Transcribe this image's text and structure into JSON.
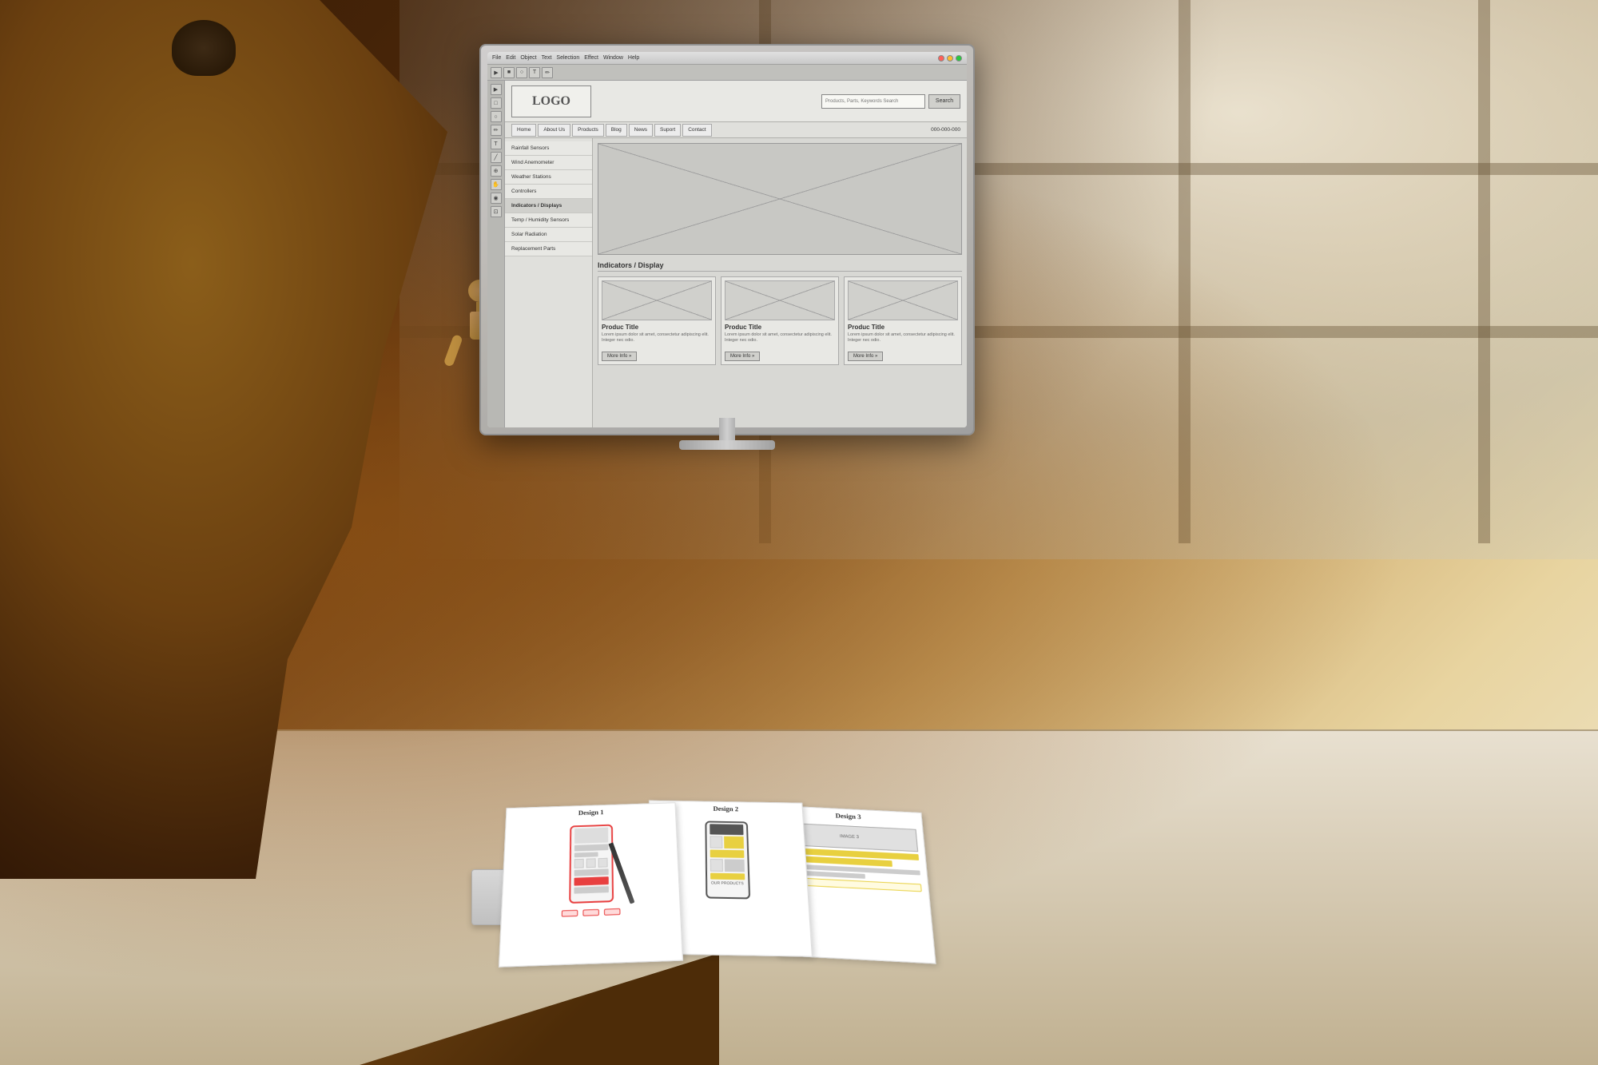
{
  "scene": {
    "title": "UI/UX Designer Working on Wireframe"
  },
  "app": {
    "title_bar": {
      "menus": [
        "File",
        "Edit",
        "Object",
        "Text",
        "Selection",
        "Effect",
        "Window",
        "Help"
      ],
      "window_controls": [
        "close",
        "minimize",
        "maximize"
      ]
    }
  },
  "wireframe": {
    "logo": "LOGO",
    "search_placeholder": "Products, Parts, Keywords Search",
    "search_button": "Search",
    "nav_items": [
      "Home",
      "About Us",
      "Products",
      "Blog",
      "News",
      "Suport",
      "Contact"
    ],
    "phone": "000-000-000",
    "menu_items": [
      "Rainfall Sensors",
      "Wind Anemometer",
      "Weather Stations",
      "Controllers",
      "Indicators / Displays",
      "Temp / Humidity Sensors",
      "Solar Radiation",
      "Replacement Parts"
    ],
    "category_title": "Indicators / Display",
    "products": [
      {
        "title": "Produc Title",
        "description": "Lorem ipsum dolor sit amet, consectetur adipiscing elit. Integer nec odio.",
        "more_info": "More Info »"
      },
      {
        "title": "Produc Title",
        "description": "Lorem ipsum dolor sit amet, consectetur adipiscing elit. Integer nec odio.",
        "more_info": "More Info »"
      },
      {
        "title": "Produc Title",
        "description": "Lorem ipsum dolor sit amet, consectetur adipiscing elit. Integer nec odio.",
        "more_info": "More Info »"
      }
    ]
  },
  "papers": {
    "design1_title": "Design 1",
    "design2_title": "Design 2",
    "design3_title": "Design 3"
  },
  "colors": {
    "accent": "#e84040",
    "yellow": "#e8d040",
    "dark": "#333333",
    "wireframe_bg": "#d0d0cc",
    "monitor_frame": "#c0bebe"
  }
}
